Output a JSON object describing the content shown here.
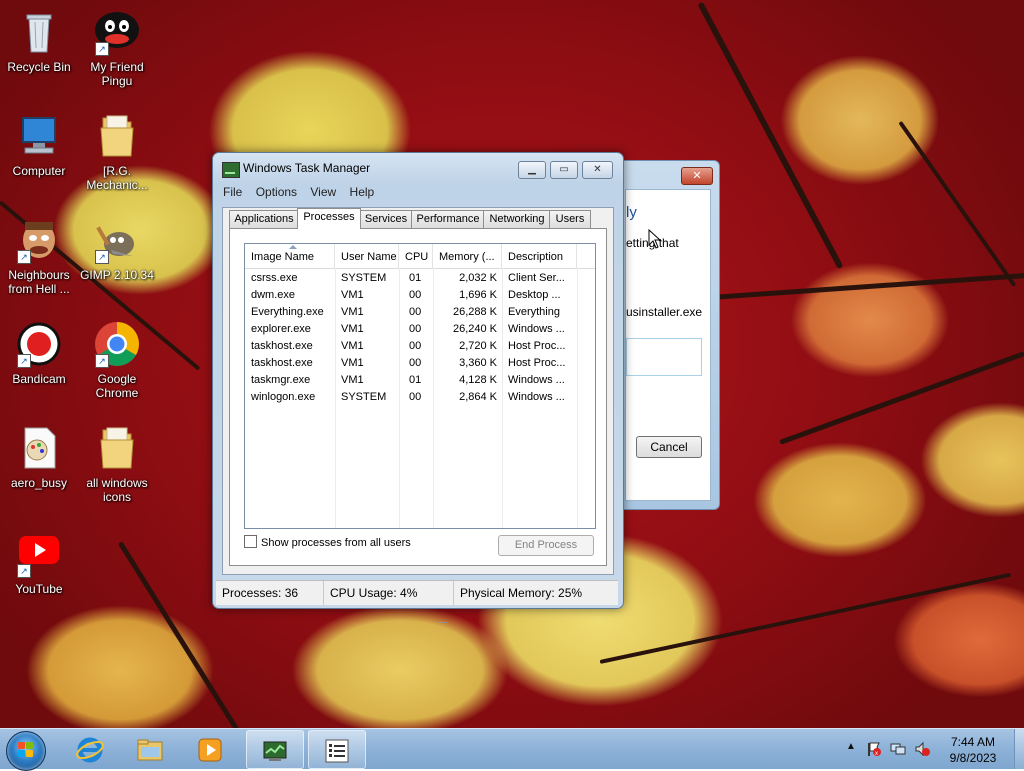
{
  "desktop": {
    "icons": [
      {
        "label": "Recycle Bin",
        "icon": "recycle-bin-icon"
      },
      {
        "label": "My Friend Pingu",
        "icon": "pingu-icon"
      },
      {
        "label": "Computer",
        "icon": "computer-icon"
      },
      {
        "label": "[R.G. Mechanic...",
        "icon": "folder-icon"
      },
      {
        "label": "Neighbours from Hell ...",
        "icon": "game-icon"
      },
      {
        "label": "GIMP 2.10.34",
        "icon": "gimp-icon"
      },
      {
        "label": "Bandicam",
        "icon": "bandicam-icon"
      },
      {
        "label": "Google Chrome",
        "icon": "chrome-icon"
      },
      {
        "label": "aero_busy",
        "icon": "paint-file-icon"
      },
      {
        "label": "all windows icons",
        "icon": "folder-icon"
      },
      {
        "label": "YouTube",
        "icon": "youtube-icon"
      }
    ]
  },
  "bg_dialog": {
    "title_fragment": "ly",
    "text_fragment": "etting that",
    "file_fragment": "usinstaller.exe",
    "cancel_label": "Cancel",
    "close_symbol": "✕"
  },
  "taskmgr": {
    "title": "Windows Task Manager",
    "buttons": {
      "minimize": "▁",
      "maximize": "▭",
      "close": "✕"
    },
    "menu": [
      "File",
      "Options",
      "View",
      "Help"
    ],
    "tabs": [
      "Applications",
      "Processes",
      "Services",
      "Performance",
      "Networking",
      "Users"
    ],
    "active_tab": "Processes",
    "columns": [
      "Image Name",
      "User Name",
      "CPU",
      "Memory (...",
      "Description"
    ],
    "processes": [
      {
        "image": "csrss.exe",
        "user": "SYSTEM",
        "cpu": "01",
        "mem": "2,032 K",
        "desc": "Client Ser..."
      },
      {
        "image": "dwm.exe",
        "user": "VM1",
        "cpu": "00",
        "mem": "1,696 K",
        "desc": "Desktop ..."
      },
      {
        "image": "Everything.exe",
        "user": "VM1",
        "cpu": "00",
        "mem": "26,288 K",
        "desc": "Everything"
      },
      {
        "image": "explorer.exe",
        "user": "VM1",
        "cpu": "00",
        "mem": "26,240 K",
        "desc": "Windows ..."
      },
      {
        "image": "taskhost.exe",
        "user": "VM1",
        "cpu": "00",
        "mem": "2,720 K",
        "desc": "Host Proc..."
      },
      {
        "image": "taskhost.exe",
        "user": "VM1",
        "cpu": "00",
        "mem": "3,360 K",
        "desc": "Host Proc..."
      },
      {
        "image": "taskmgr.exe",
        "user": "VM1",
        "cpu": "01",
        "mem": "4,128 K",
        "desc": "Windows ..."
      },
      {
        "image": "winlogon.exe",
        "user": "SYSTEM",
        "cpu": "00",
        "mem": "2,864 K",
        "desc": "Windows ..."
      }
    ],
    "show_all_label": "Show processes from all users",
    "end_process_label": "End Process",
    "status": {
      "processes": "Processes: 36",
      "cpu": "CPU Usage: 4%",
      "memory": "Physical Memory: 25%"
    }
  },
  "taskbar": {
    "pinned": [
      {
        "name": "internet-explorer",
        "icon": "ie-icon"
      },
      {
        "name": "windows-explorer",
        "icon": "explorer-icon"
      },
      {
        "name": "media-player",
        "icon": "media-player-icon"
      },
      {
        "name": "task-manager",
        "icon": "task-manager-icon"
      },
      {
        "name": "installer-window",
        "icon": "list-window-icon"
      }
    ],
    "tray_arrow": "▲",
    "time": "7:44 AM",
    "date": "9/8/2023"
  },
  "colors": {
    "accent": "#1f4e9c",
    "wallpaper_red": "#8d0d12",
    "leaf_yellow": "#e2c85a"
  }
}
